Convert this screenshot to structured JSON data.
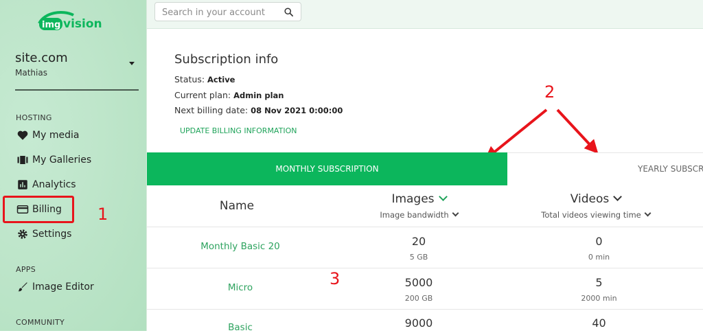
{
  "brand": {
    "logo_text": "imgvision"
  },
  "account": {
    "site": "site.com",
    "user": "Mathias"
  },
  "sidebar": {
    "hosting_label": "HOSTING",
    "items": [
      {
        "label": "My media",
        "icon": "heart-icon"
      },
      {
        "label": "My Galleries",
        "icon": "galleries-icon"
      },
      {
        "label": "Analytics",
        "icon": "analytics-icon"
      },
      {
        "label": "Billing",
        "icon": "credit-card-icon"
      },
      {
        "label": "Settings",
        "icon": "gear-icon"
      }
    ],
    "apps_label": "APPS",
    "apps_items": [
      {
        "label": "Image Editor",
        "icon": "brush-icon"
      }
    ],
    "community_label": "COMMUNITY"
  },
  "search": {
    "placeholder": "Search in your account"
  },
  "subscription": {
    "title": "Subscription info",
    "status_label": "Status:",
    "status_value": "Active",
    "plan_label": "Current plan:",
    "plan_value": "Admin plan",
    "next_billing_label": "Next billing date:",
    "next_billing_value": "08 Nov 2021 0:00:00",
    "update_link": "UPDATE BILLING INFORMATION"
  },
  "tabs": {
    "monthly": "MONTHLY SUBSCRIPTION",
    "yearly": "YEARLY SUBSCRIPTION"
  },
  "table": {
    "col_name": "Name",
    "col_images": "Images",
    "col_images_sub": "Image bandwidth",
    "col_videos": "Videos",
    "col_videos_sub": "Total videos viewing time",
    "rows": [
      {
        "name": "Monthly Basic 20",
        "images": "20",
        "images_sub": "5 GB",
        "videos": "0",
        "videos_sub": "0 min"
      },
      {
        "name": "Micro",
        "images": "5000",
        "images_sub": "200 GB",
        "videos": "5",
        "videos_sub": "2000 min"
      },
      {
        "name": "Basic",
        "images": "9000",
        "videos": "40"
      }
    ]
  },
  "annotations": {
    "one": "1",
    "two": "2",
    "three": "3"
  },
  "colors": {
    "accent": "#0cb65c",
    "annotation": "#e8141b",
    "sidebar_bg": "#bfe6cb"
  }
}
